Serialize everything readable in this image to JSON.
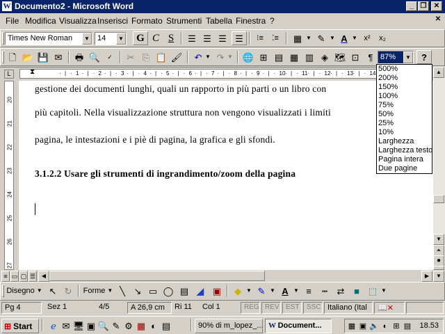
{
  "window": {
    "title": "Documento2 - Microsoft Word",
    "app_icon_glyph": "W",
    "controls": {
      "minimize": "_",
      "restore": "❐",
      "close": "✕"
    }
  },
  "menubar": {
    "items": [
      {
        "label": "File"
      },
      {
        "label": "Modifica"
      },
      {
        "label": "Visualizza"
      },
      {
        "label": "Inserisci"
      },
      {
        "label": "Formato"
      },
      {
        "label": "Strumenti"
      },
      {
        "label": "Tabella"
      },
      {
        "label": "Finestra"
      },
      {
        "label": "?"
      }
    ],
    "close_doc": "✕"
  },
  "formatting_toolbar": {
    "font_name": "Times New Roman",
    "font_size": "14",
    "bold": "G",
    "italic": "C",
    "underline": "S",
    "superscript": "x²",
    "subscript": "x₂",
    "font_color_letter": "A"
  },
  "standard_toolbar": {
    "zoom_value": "87%",
    "help": "?",
    "pilcrow": "¶"
  },
  "zoom_dropdown": {
    "options": [
      "500%",
      "200%",
      "150%",
      "100%",
      "75%",
      "50%",
      "25%",
      "10%",
      "Larghezza",
      "Larghezza testo",
      "Pagina intera",
      "Due pagine"
    ]
  },
  "ruler": {
    "h_numbers": [
      "1",
      "2",
      "3",
      "4",
      "5",
      "6",
      "7",
      "8",
      "9",
      "10",
      "11",
      "12",
      "13",
      "14"
    ],
    "v_numbers": [
      "20",
      "21",
      "22",
      "23",
      "24",
      "25",
      "26",
      "27"
    ]
  },
  "document": {
    "lines": [
      "gestione dei documenti lunghi, quali un rapporto in più parti o un libro con",
      "più capitoli. Nella visualizzazione struttura non vengono visualizzati i limiti",
      "pagina, le intestazioni e i piè di pagina, la grafica e gli sfondi."
    ],
    "heading": "3.1.2.2 Usare gli strumenti di ingrandimento/zoom della pagina"
  },
  "drawing_toolbar": {
    "draw_label": "Disegno",
    "shapes_label": "Forme",
    "font_color_letter": "A"
  },
  "statusbar": {
    "page": "Pg 4",
    "section": "Sez 1",
    "pages": "4/5",
    "position": "A 26,9 cm",
    "line": "Ri 11",
    "column": "Col 1",
    "rec": "REG",
    "rev": "REV",
    "ext": "EST",
    "ovr": "SSC",
    "language": "Italiano (Ital"
  },
  "taskbar": {
    "start_label": "Start",
    "items": [
      "90% di m_lopez_...",
      "Document..."
    ],
    "clock": "18.53"
  },
  "colors": {
    "title_bar": "#0a246a",
    "chrome": "#d4d0c8",
    "selection": "#0a246a"
  }
}
